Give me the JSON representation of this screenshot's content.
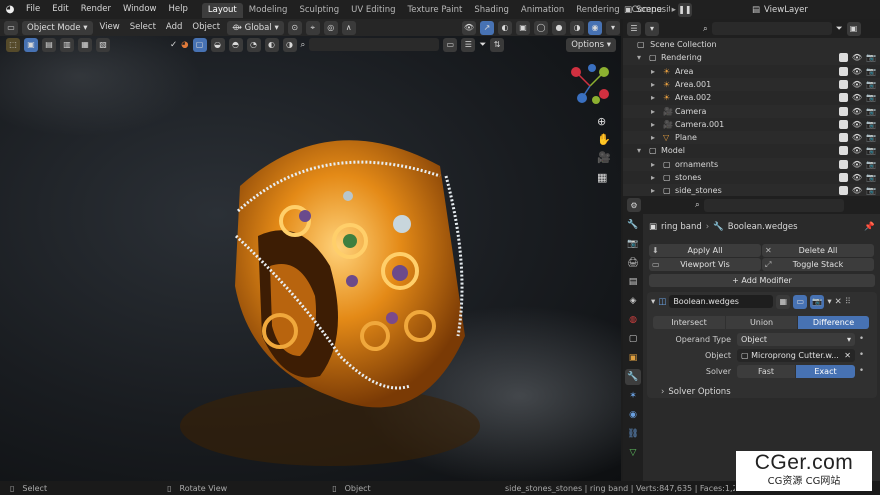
{
  "menu": {
    "items": [
      "File",
      "Edit",
      "Render",
      "Window",
      "Help"
    ]
  },
  "workspaces": {
    "tabs": [
      "Layout",
      "Modeling",
      "Sculpting",
      "UV Editing",
      "Texture Paint",
      "Shading",
      "Animation",
      "Rendering",
      "Compositin"
    ],
    "active": "Layout"
  },
  "header": {
    "scene": "Scene",
    "view_layer": "ViewLayer"
  },
  "viewport": {
    "mode": "Object Mode",
    "menus": [
      "View",
      "Select",
      "Add",
      "Object"
    ],
    "transform": "Global",
    "options": "Options"
  },
  "outliner": {
    "root": "Scene Collection",
    "rows": [
      {
        "label": "Rendering",
        "indent": 1
      },
      {
        "label": "Area",
        "indent": 2
      },
      {
        "label": "Area.001",
        "indent": 2
      },
      {
        "label": "Area.002",
        "indent": 2
      },
      {
        "label": "Camera",
        "indent": 2
      },
      {
        "label": "Camera.001",
        "indent": 2
      },
      {
        "label": "Plane",
        "indent": 2
      },
      {
        "label": "Model",
        "indent": 1
      },
      {
        "label": "ornaments",
        "indent": 2
      },
      {
        "label": "stones",
        "indent": 2
      },
      {
        "label": "side_stones",
        "indent": 2
      }
    ]
  },
  "properties": {
    "breadcrumb_object": "ring band",
    "breadcrumb_modifier": "Boolean.wedges",
    "apply_all": "Apply All",
    "delete_all": "Delete All",
    "viewport_vis": "Viewport Vis",
    "toggle_stack": "Toggle Stack",
    "add_modifier": "Add Modifier",
    "modifier_name": "Boolean.wedges",
    "operations": [
      "Intersect",
      "Union",
      "Difference"
    ],
    "operation_active": "Difference",
    "operand_type_label": "Operand Type",
    "operand_type_value": "Object",
    "object_label": "Object",
    "object_value": "Microprong Cutter.w...",
    "solver_label": "Solver",
    "solvers": [
      "Fast",
      "Exact"
    ],
    "solver_active": "Exact",
    "solver_options": "Solver Options"
  },
  "status": {
    "select": "Select",
    "rotate": "Rotate View",
    "object": "Object",
    "info": "side_stones_stones | ring band | Verts:847,635 | Faces:1,258,"
  },
  "watermark": {
    "site": "CGer.com",
    "sub": "CG资源 CG网站"
  },
  "colors": {
    "accent": "#4772b3",
    "gold": "#d98a1a"
  }
}
